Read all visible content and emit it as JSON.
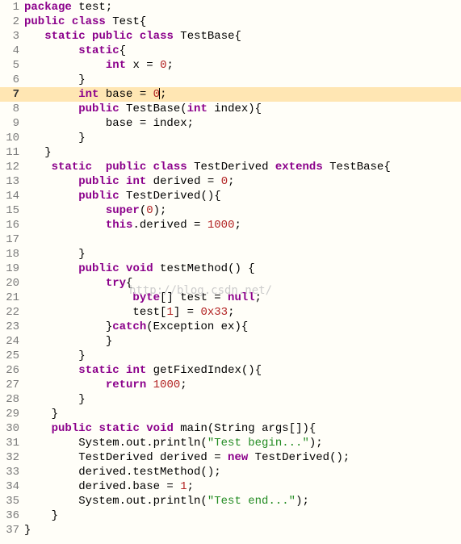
{
  "file": "Test.java",
  "language": "java",
  "highlighted_line": 7,
  "watermark": "http://blog.csdn.net/",
  "lines": [
    {
      "n": "1",
      "seg": [
        [
          "kw",
          "package"
        ],
        [
          "plain",
          " test;"
        ]
      ]
    },
    {
      "n": "2",
      "seg": [
        [
          "kw",
          "public"
        ],
        [
          "plain",
          " "
        ],
        [
          "kw",
          "class"
        ],
        [
          "plain",
          " Test{"
        ]
      ]
    },
    {
      "n": "3",
      "seg": [
        [
          "plain",
          "   "
        ],
        [
          "kw",
          "static"
        ],
        [
          "plain",
          " "
        ],
        [
          "kw",
          "public"
        ],
        [
          "plain",
          " "
        ],
        [
          "kw",
          "class"
        ],
        [
          "plain",
          " TestBase{"
        ]
      ]
    },
    {
      "n": "4",
      "seg": [
        [
          "plain",
          "        "
        ],
        [
          "kw",
          "static"
        ],
        [
          "plain",
          "{"
        ]
      ]
    },
    {
      "n": "5",
      "seg": [
        [
          "plain",
          "            "
        ],
        [
          "kw",
          "int"
        ],
        [
          "plain",
          " x = "
        ],
        [
          "num",
          "0"
        ],
        [
          "plain",
          ";"
        ]
      ]
    },
    {
      "n": "6",
      "seg": [
        [
          "plain",
          "        }"
        ]
      ]
    },
    {
      "n": "7",
      "seg": [
        [
          "plain",
          "        "
        ],
        [
          "kw",
          "int"
        ],
        [
          "plain",
          " base = "
        ],
        [
          "num",
          "0"
        ],
        [
          "cursor",
          ""
        ],
        [
          "plain",
          ";"
        ]
      ],
      "hl": true
    },
    {
      "n": "8",
      "seg": [
        [
          "plain",
          "        "
        ],
        [
          "kw",
          "public"
        ],
        [
          "plain",
          " TestBase("
        ],
        [
          "kw",
          "int"
        ],
        [
          "plain",
          " index){"
        ]
      ]
    },
    {
      "n": "9",
      "seg": [
        [
          "plain",
          "            base = index;"
        ]
      ]
    },
    {
      "n": "10",
      "seg": [
        [
          "plain",
          "        }"
        ]
      ]
    },
    {
      "n": "11",
      "seg": [
        [
          "plain",
          "   }"
        ]
      ]
    },
    {
      "n": "12",
      "seg": [
        [
          "plain",
          "    "
        ],
        [
          "kw",
          "static"
        ],
        [
          "plain",
          "  "
        ],
        [
          "kw",
          "public"
        ],
        [
          "plain",
          " "
        ],
        [
          "kw",
          "class"
        ],
        [
          "plain",
          " TestDerived "
        ],
        [
          "kw",
          "extends"
        ],
        [
          "plain",
          " TestBase{"
        ]
      ]
    },
    {
      "n": "13",
      "seg": [
        [
          "plain",
          "        "
        ],
        [
          "kw",
          "public"
        ],
        [
          "plain",
          " "
        ],
        [
          "kw",
          "int"
        ],
        [
          "plain",
          " derived = "
        ],
        [
          "num",
          "0"
        ],
        [
          "plain",
          ";"
        ]
      ]
    },
    {
      "n": "14",
      "seg": [
        [
          "plain",
          "        "
        ],
        [
          "kw",
          "public"
        ],
        [
          "plain",
          " TestDerived(){"
        ]
      ]
    },
    {
      "n": "15",
      "seg": [
        [
          "plain",
          "            "
        ],
        [
          "kw",
          "super"
        ],
        [
          "plain",
          "("
        ],
        [
          "num",
          "0"
        ],
        [
          "plain",
          ");"
        ]
      ]
    },
    {
      "n": "16",
      "seg": [
        [
          "plain",
          "            "
        ],
        [
          "kw",
          "this"
        ],
        [
          "plain",
          ".derived = "
        ],
        [
          "num",
          "1000"
        ],
        [
          "plain",
          ";"
        ]
      ]
    },
    {
      "n": "17",
      "seg": [
        [
          "plain",
          ""
        ]
      ]
    },
    {
      "n": "18",
      "seg": [
        [
          "plain",
          "        }"
        ]
      ]
    },
    {
      "n": "19",
      "seg": [
        [
          "plain",
          "        "
        ],
        [
          "kw",
          "public"
        ],
        [
          "plain",
          " "
        ],
        [
          "kw",
          "void"
        ],
        [
          "plain",
          " testMethod() {"
        ]
      ]
    },
    {
      "n": "20",
      "seg": [
        [
          "plain",
          "            "
        ],
        [
          "kw",
          "try"
        ],
        [
          "plain",
          "{"
        ]
      ]
    },
    {
      "n": "21",
      "seg": [
        [
          "plain",
          "                "
        ],
        [
          "kw",
          "byte"
        ],
        [
          "plain",
          "[] test = "
        ],
        [
          "kw",
          "null"
        ],
        [
          "plain",
          ";"
        ]
      ]
    },
    {
      "n": "22",
      "seg": [
        [
          "plain",
          "                test["
        ],
        [
          "num",
          "1"
        ],
        [
          "plain",
          "] = "
        ],
        [
          "num",
          "0x33"
        ],
        [
          "plain",
          ";"
        ]
      ]
    },
    {
      "n": "23",
      "seg": [
        [
          "plain",
          "            }"
        ],
        [
          "kw",
          "catch"
        ],
        [
          "plain",
          "(Exception ex){"
        ]
      ]
    },
    {
      "n": "24",
      "seg": [
        [
          "plain",
          "            }"
        ]
      ]
    },
    {
      "n": "25",
      "seg": [
        [
          "plain",
          "        }"
        ]
      ]
    },
    {
      "n": "26",
      "seg": [
        [
          "plain",
          "        "
        ],
        [
          "kw",
          "static"
        ],
        [
          "plain",
          " "
        ],
        [
          "kw",
          "int"
        ],
        [
          "plain",
          " getFixedIndex(){"
        ]
      ]
    },
    {
      "n": "27",
      "seg": [
        [
          "plain",
          "            "
        ],
        [
          "kw",
          "return"
        ],
        [
          "plain",
          " "
        ],
        [
          "num",
          "1000"
        ],
        [
          "plain",
          ";"
        ]
      ]
    },
    {
      "n": "28",
      "seg": [
        [
          "plain",
          "        }"
        ]
      ]
    },
    {
      "n": "29",
      "seg": [
        [
          "plain",
          "    }"
        ]
      ]
    },
    {
      "n": "30",
      "seg": [
        [
          "plain",
          "    "
        ],
        [
          "kw",
          "public"
        ],
        [
          "plain",
          " "
        ],
        [
          "kw",
          "static"
        ],
        [
          "plain",
          " "
        ],
        [
          "kw",
          "void"
        ],
        [
          "plain",
          " main(String args[]){"
        ]
      ]
    },
    {
      "n": "31",
      "seg": [
        [
          "plain",
          "        System.out.println("
        ],
        [
          "str",
          "\"Test begin...\""
        ],
        [
          "plain",
          ");"
        ]
      ]
    },
    {
      "n": "32",
      "seg": [
        [
          "plain",
          "        TestDerived derived = "
        ],
        [
          "kw",
          "new"
        ],
        [
          "plain",
          " TestDerived();"
        ]
      ]
    },
    {
      "n": "33",
      "seg": [
        [
          "plain",
          "        derived.testMethod();"
        ]
      ]
    },
    {
      "n": "34",
      "seg": [
        [
          "plain",
          "        derived.base = "
        ],
        [
          "num",
          "1"
        ],
        [
          "plain",
          ";"
        ]
      ]
    },
    {
      "n": "35",
      "seg": [
        [
          "plain",
          "        System.out.println("
        ],
        [
          "str",
          "\"Test end...\""
        ],
        [
          "plain",
          ");"
        ]
      ]
    },
    {
      "n": "36",
      "seg": [
        [
          "plain",
          "    }"
        ]
      ]
    },
    {
      "n": "37",
      "seg": [
        [
          "plain",
          "}"
        ]
      ]
    }
  ]
}
